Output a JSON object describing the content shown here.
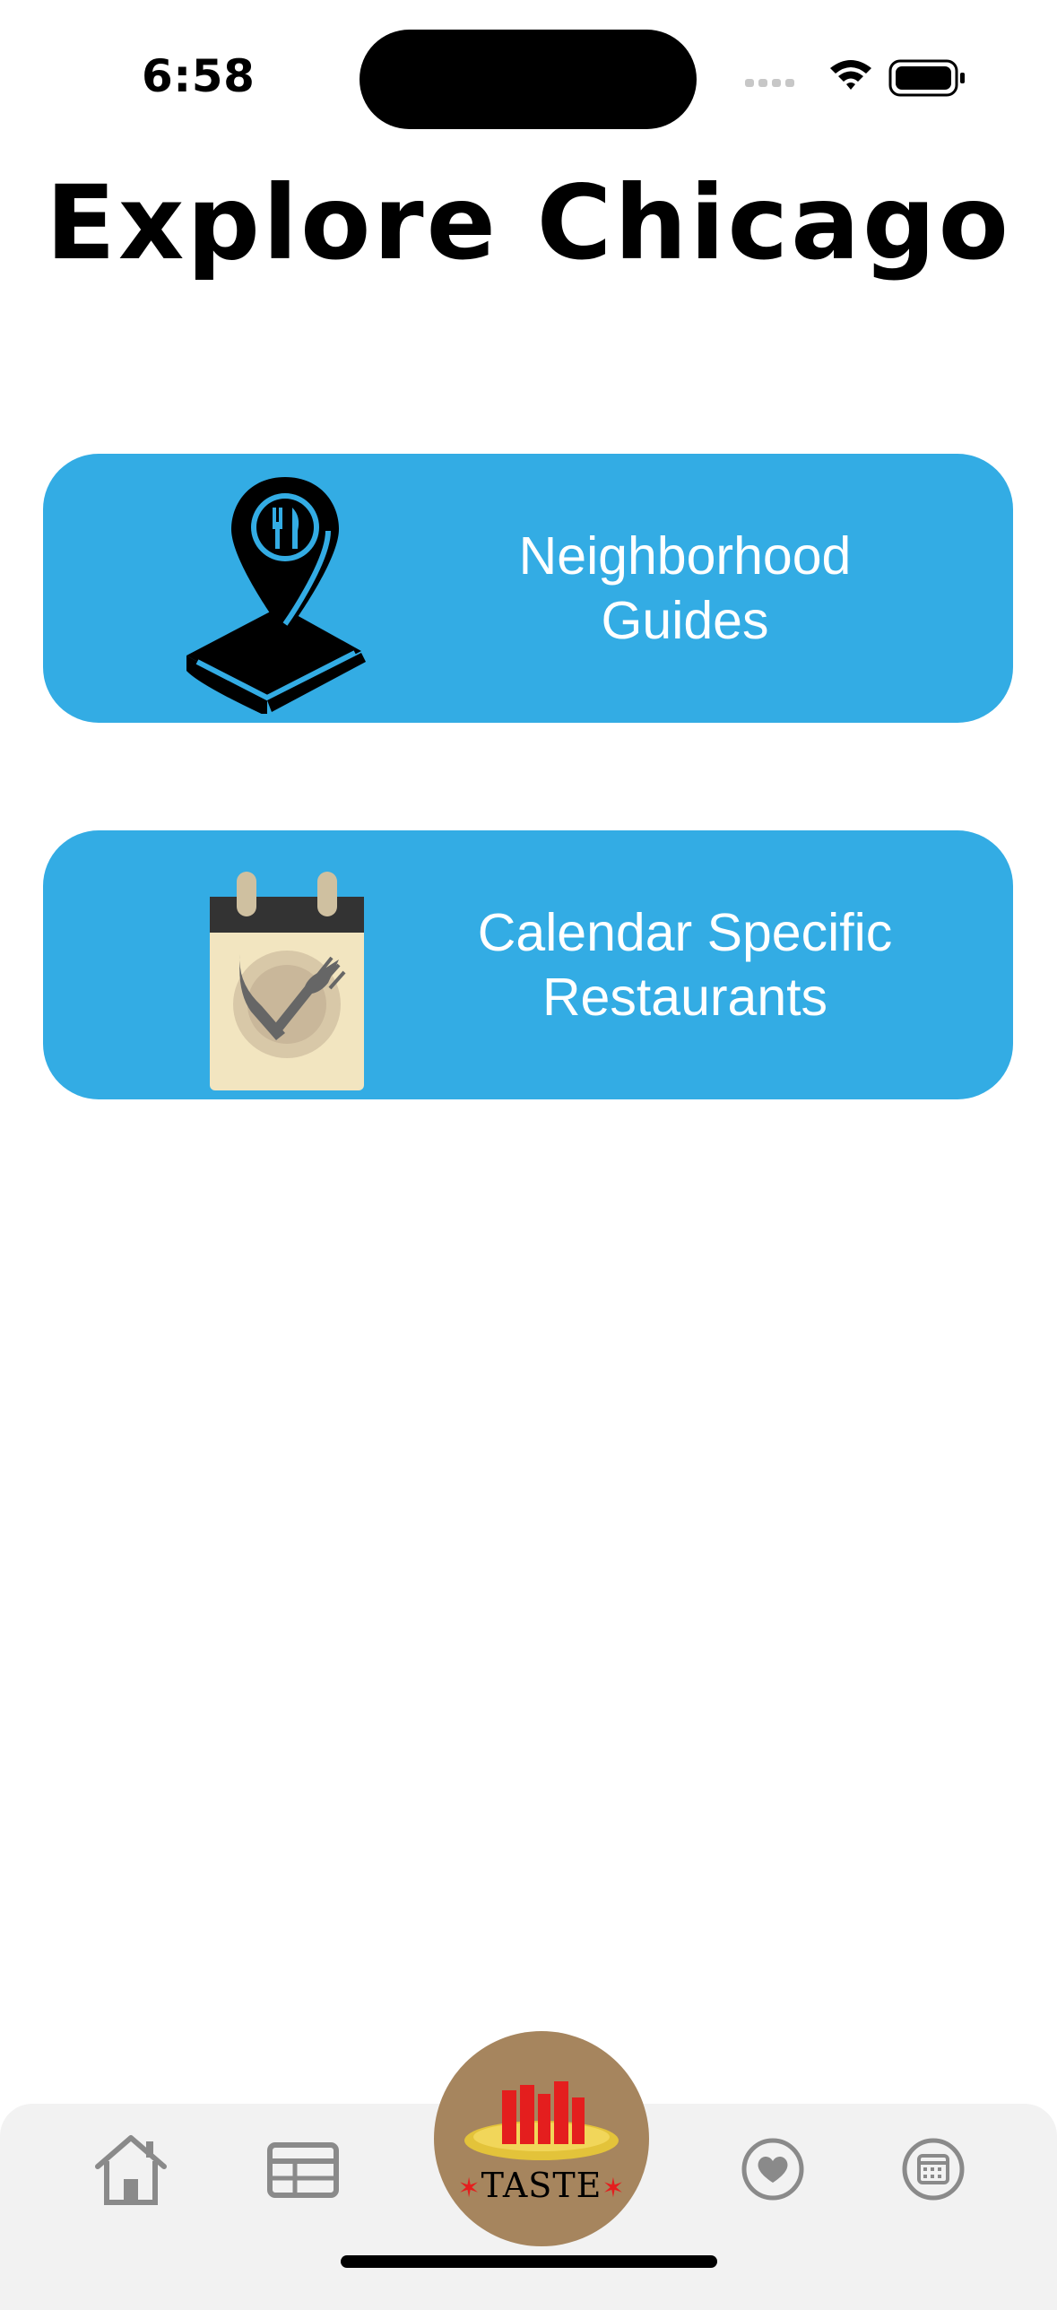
{
  "status_bar": {
    "time": "6:58"
  },
  "header": {
    "title": "Explore Chicago"
  },
  "cards": [
    {
      "line1": "Neighborhood",
      "line2": "Guides",
      "icon": "map-pin-book-icon"
    },
    {
      "line1": "Calendar Specific",
      "line2": "Restaurants",
      "icon": "calendar-plate-icon"
    }
  ],
  "tab_bar": {
    "center_label": "TASTE",
    "center_star": "✶",
    "icons": [
      "house-icon",
      "table-icon",
      "taste-logo",
      "heart-icon",
      "calendar-icon"
    ]
  },
  "colors": {
    "card_bg": "#33ace4",
    "tabbar_bg": "#f2f2f2",
    "tab_icon": "#8a8a8a",
    "taste_badge": "#a6855e",
    "taste_star": "#e41e1e"
  }
}
